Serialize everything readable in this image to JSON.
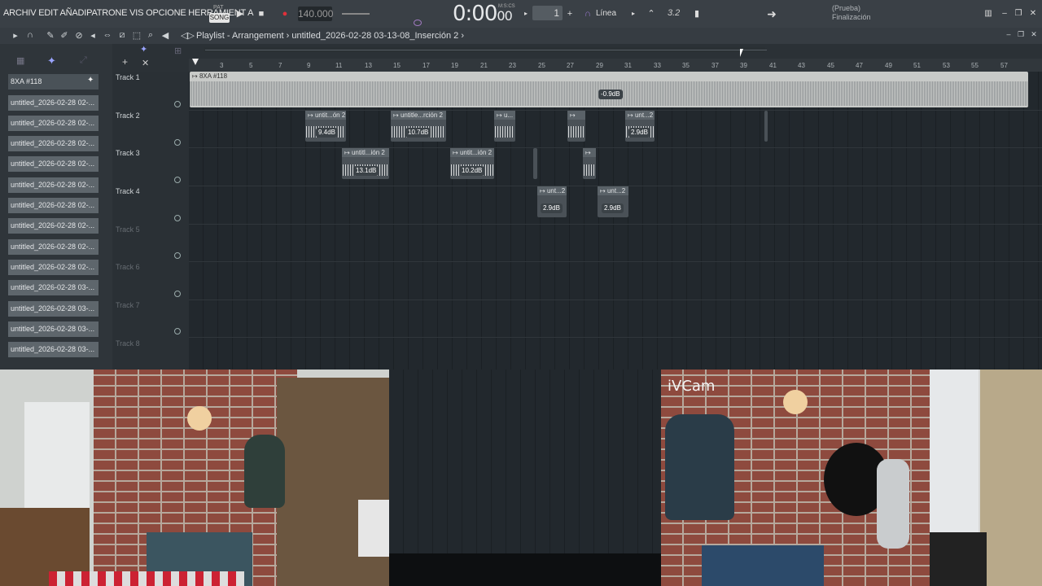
{
  "menu": {
    "text": "ARCHIV EDIT AÑADIPATRONE VIS OPCIONE HERRAMIENT A"
  },
  "transport": {
    "pat_label": "PAT",
    "song_label": "SONG",
    "tempo": "140.000",
    "time_main": "0:00",
    "time_sub": "00",
    "time_units": "M:S:CS",
    "step": "1",
    "snap": "Línea",
    "time_sig": "3.2"
  },
  "hint": {
    "line1": "(Prueba)",
    "line2": "Finalización"
  },
  "playlist": {
    "title": "Playlist - Arrangement",
    "pattern": "untitled_2026-02-28 03-13-08_Inserción 2"
  },
  "browser": {
    "items": [
      "8XA #118",
      "untitled_2026-02-28 02-...",
      "untitled_2026-02-28 02-...",
      "untitled_2026-02-28 02-...",
      "untitled_2026-02-28 02-...",
      "untitled_2026-02-28 02-...",
      "untitled_2026-02-28 02-...",
      "untitled_2026-02-28 02-...",
      "untitled_2026-02-28 02-...",
      "untitled_2026-02-28 02-...",
      "untitled_2026-02-28 03-...",
      "untitled_2026-02-28 03-...",
      "untitled_2026-02-28 03-...",
      "untitled_2026-02-28 03-..."
    ]
  },
  "tracks": [
    "Track 1",
    "Track 2",
    "Track 3",
    "Track 4",
    "Track 5",
    "Track 6",
    "Track 7",
    "Track 8"
  ],
  "ruler": [
    "3",
    "5",
    "7",
    "9",
    "11",
    "13",
    "15",
    "17",
    "19",
    "21",
    "23",
    "25",
    "27",
    "29",
    "31",
    "33",
    "35",
    "37",
    "39",
    "41",
    "43",
    "45",
    "47",
    "49",
    "51",
    "53",
    "55",
    "57"
  ],
  "clips": {
    "t1_name": "8XA #118",
    "t1_db": "-0.9dB",
    "t2a_name": "untit...ón 2",
    "t2a_db": "9.4dB",
    "t2b_name": "untitle...rción 2",
    "t2b_db": "10.7dB",
    "t2c_name": "u...",
    "t2e_name": "unt...2",
    "t2e_db": "2.9dB",
    "t3a_name": "untitl...ión 2",
    "t3a_db": "13.1dB",
    "t3b_name": "untit...ión 2",
    "t3b_db": "10.2dB",
    "t4a_name": "unt...2",
    "t4a_db": "2.9dB",
    "t4b_name": "unt...2",
    "t4b_db": "2.9dB"
  },
  "webcam": {
    "label": "iVCam"
  }
}
